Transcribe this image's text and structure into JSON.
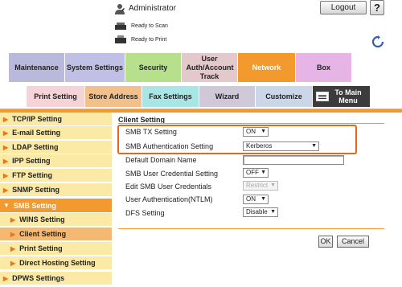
{
  "header": {
    "user_label": "Administrator",
    "logout_label": "Logout",
    "help_label": "?",
    "status_scan": "Ready to Scan",
    "status_print": "Ready to Print"
  },
  "main_tabs": [
    {
      "label": "Maintenance"
    },
    {
      "label": "System Settings"
    },
    {
      "label": "Security"
    },
    {
      "label": "User Auth/Account Track"
    },
    {
      "label": "Network"
    },
    {
      "label": "Box"
    }
  ],
  "sub_tabs": [
    {
      "label": "Print Setting"
    },
    {
      "label": "Store Address"
    },
    {
      "label": "Fax Settings"
    },
    {
      "label": "Wizard"
    },
    {
      "label": "Customize"
    },
    {
      "label": "To Main Menu"
    }
  ],
  "sidebar": {
    "items": [
      {
        "label": "TCP/IP Setting"
      },
      {
        "label": "E-mail Setting"
      },
      {
        "label": "LDAP Setting"
      },
      {
        "label": "IPP Setting"
      },
      {
        "label": "FTP Setting"
      },
      {
        "label": "SNMP Setting"
      },
      {
        "label": "SMB Setting"
      },
      {
        "label": "WINS Setting"
      },
      {
        "label": "Client Setting"
      },
      {
        "label": "Print Setting"
      },
      {
        "label": "Direct Hosting Setting"
      },
      {
        "label": "DPWS Settings"
      }
    ]
  },
  "content": {
    "title": "Client Setting",
    "rows": [
      {
        "label": "SMB TX Setting",
        "value": "ON"
      },
      {
        "label": "SMB Authentication Setting",
        "value": "Kerberos"
      },
      {
        "label": "Default Domain Name",
        "value": ""
      },
      {
        "label": "SMB User Credential Setting",
        "value": "OFF"
      },
      {
        "label": "Edit SMB User Credentials",
        "value": "Restrict"
      },
      {
        "label": "User Authentication(NTLM)",
        "value": "ON"
      },
      {
        "label": "DFS Setting",
        "value": "Disable"
      }
    ],
    "ok_label": "OK",
    "cancel_label": "Cancel"
  },
  "colors": {
    "network_accent": "#f29a2d",
    "highlight_border": "#e8651a",
    "sidebar_bg": "#fbe9a6"
  }
}
